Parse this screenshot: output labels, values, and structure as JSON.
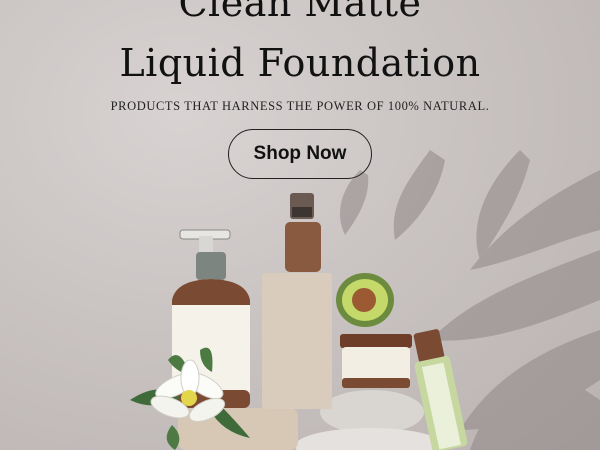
{
  "banner": {
    "title_line1": "Clean Matte",
    "title_line2": "Liquid Foundation",
    "subtitle": "PRODUCTS THAT HARNESS THE POWER OF 100% NATURAL.",
    "cta_label": "Shop Now"
  },
  "icons": {
    "pump_bottle": "pump-bottle-icon",
    "dropper_bottle": "dropper-bottle-icon",
    "avocado": "avocado-icon",
    "jar": "cream-jar-icon",
    "tube": "tube-icon",
    "flower": "flower-icon"
  },
  "colors": {
    "background": "#c9c3c2",
    "text": "#111111",
    "brown": "#6b3f2a",
    "cream": "#f3efe6",
    "beige": "#d6cbbd",
    "green": "#b8cf8e"
  }
}
